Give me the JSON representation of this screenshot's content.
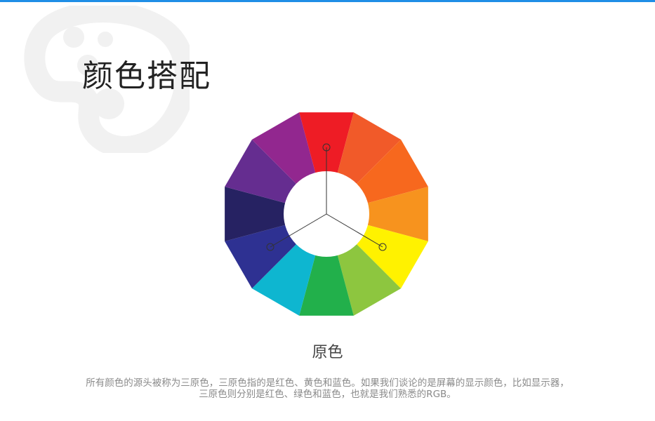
{
  "theme": {
    "accent": "#1f8ee6",
    "watermark": "#f1f1f1"
  },
  "header": {
    "title": "颜色搭配",
    "watermark_icon": "palette-icon"
  },
  "wheel": {
    "segments": [
      "#ee1c25",
      "#f15a29",
      "#f7681e",
      "#f7931e",
      "#fff200",
      "#8dc63f",
      "#22b04b",
      "#0eb6d0",
      "#2e3192",
      "#262262",
      "#652d90",
      "#92278f"
    ],
    "primaries": [
      "red",
      "yellow",
      "blue"
    ]
  },
  "caption": {
    "subtitle": "原色",
    "line1": "所有颜色的源头被称为三原色，三原色指的是红色、黄色和蓝色。如果我们谈论的是屏幕的显示颜色，比如显示器，",
    "line2": "三原色则分别是红色、绿色和蓝色，也就是我们熟悉的RGB。"
  }
}
